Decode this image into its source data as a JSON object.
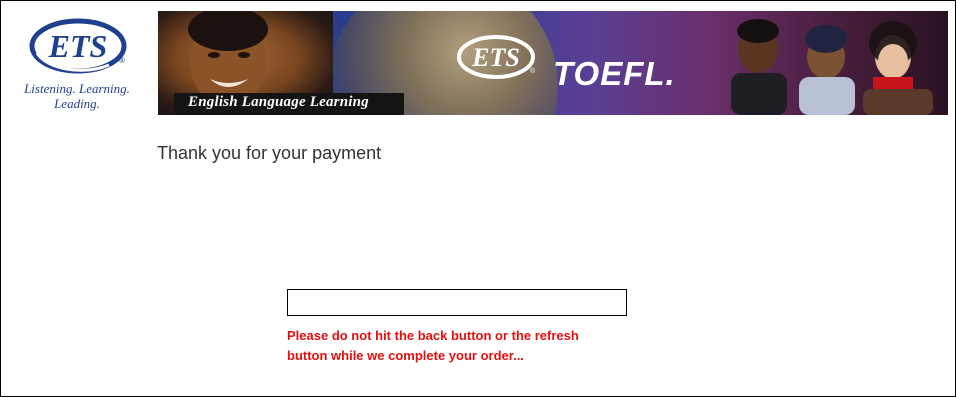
{
  "logo": {
    "brand": "ETS",
    "registered_mark": "®",
    "tagline_line1": "Listening. Learning.",
    "tagline_line2": "Leading.",
    "color": "#1f3f8f"
  },
  "banner": {
    "subtitle": "English Language Learning",
    "brand": "ETS",
    "product": "TOEFL.",
    "registered_mark": "®"
  },
  "main": {
    "title": "Thank you for your payment",
    "progress_value": 0,
    "warning_line1": "Please do not hit the back button or the refresh",
    "warning_line2": "button while we complete your order...",
    "warning_color": "#e41010"
  }
}
